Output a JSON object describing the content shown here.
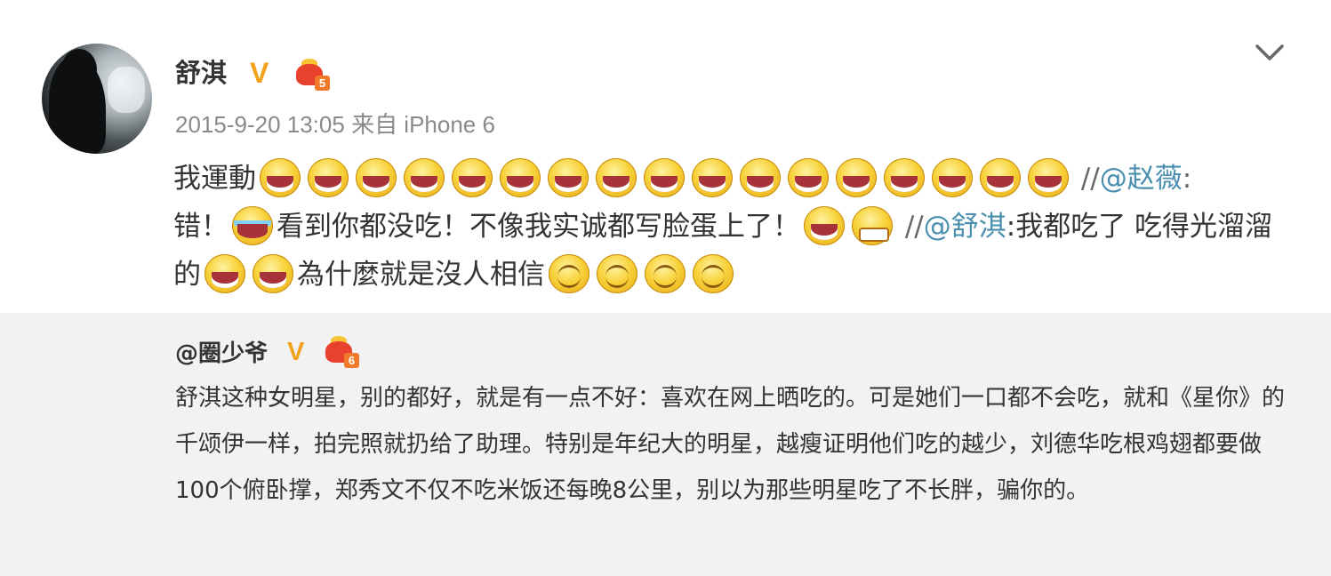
{
  "post": {
    "username": "舒淇",
    "verified_mark": "V",
    "level": "5",
    "timestamp": "2015-9-20 13:05",
    "source": "来自 iPhone 6",
    "menu_icon": "chevron-down-icon",
    "segments": {
      "intro": "我運動",
      "sep1": " //",
      "mention1": "@赵薇",
      "colon1": ":",
      "cuo": "错！",
      "seen": "看到你都没吃！不像我实诚都写脸蛋上了！",
      "sep2": " //",
      "mention2": "@舒淇",
      "quote1": ":我都吃了 吃得光溜溜的",
      "quote2": "為什麼就是沒人相信"
    },
    "emoji_names": {
      "laugh": "laughing-emoji",
      "tears": "tears-of-joy-emoji",
      "grimace": "grimace-emoji",
      "smirk": "smirk-emoji"
    }
  },
  "repost": {
    "username": "@圈少爷",
    "verified_mark": "V",
    "level": "6",
    "text": "舒淇这种女明星，别的都好，就是有一点不好：喜欢在网上晒吃的。可是她们一口都不会吃，就和《星你》的千颂伊一样，拍完照就扔给了助理。特别是年纪大的明星，越瘦证明他们吃的越少，刘德华吃根鸡翅都要做100个俯卧撑，郑秀文不仅不吃米饭还每晚8公里，别以为那些明星吃了不长胖，骗你的。"
  },
  "colors": {
    "mention": "#4a8faf",
    "verified": "#f2a21a",
    "repost_bg": "#f2f2f5",
    "meta": "#8a8a8a"
  }
}
